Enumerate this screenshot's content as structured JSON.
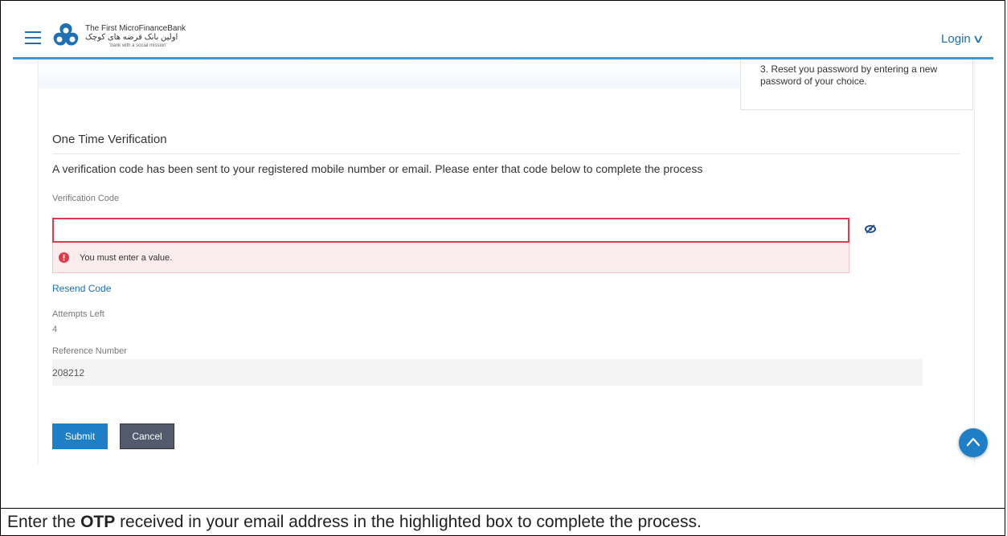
{
  "header": {
    "brand_en": "The First MicroFinanceBank",
    "brand_fa": "اولین بانک قرضه های کوچک",
    "brand_tagline": "'bank with a social mission'",
    "login_label": "Login",
    "accent_color": "#3a9ad9"
  },
  "side_note": {
    "text": "3. Reset you password by entering a new password of your choice."
  },
  "otp_section": {
    "title": "One Time Verification",
    "instruction": "A verification code has been sent to your registered mobile number or email. Please enter that code below to complete the process",
    "code_label": "Verification Code",
    "code_value": "",
    "error_message": "You must enter a value.",
    "error_color": "#e0394a",
    "resend_label": "Resend Code",
    "attempts_label": "Attempts Left",
    "attempts_value": "4",
    "reference_label": "Reference Number",
    "reference_value": "208212"
  },
  "actions": {
    "submit_label": "Submit",
    "cancel_label": "Cancel"
  },
  "caption": {
    "before": "Enter the ",
    "bold": "OTP",
    "after": " received in your email address in the highlighted box to complete the process."
  },
  "icons": [
    "hamburger-icon",
    "bank-logo-icon",
    "chevron-down-icon",
    "eye-icon",
    "error-icon",
    "chevron-up-icon"
  ]
}
